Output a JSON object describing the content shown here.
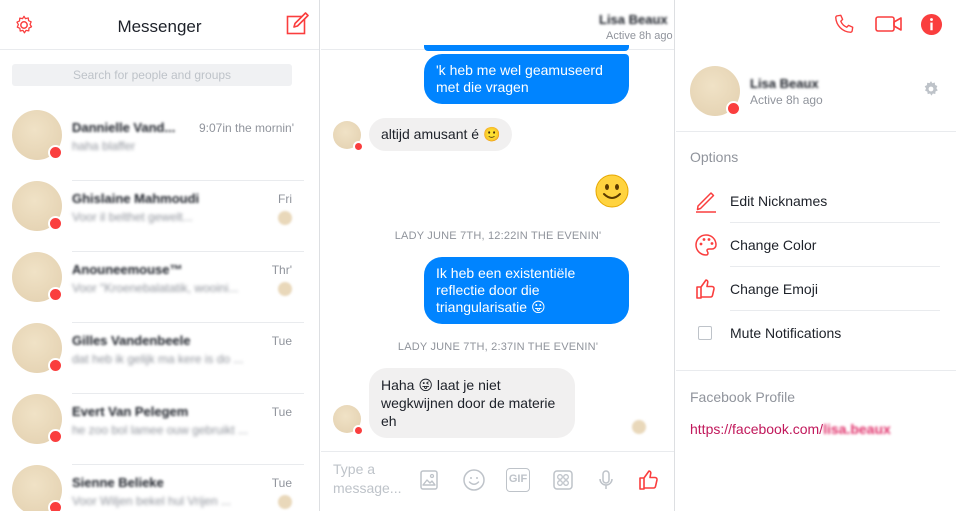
{
  "app": {
    "title": "Messenger",
    "search_placeholder": "Search for people and groups"
  },
  "conversations": [
    {
      "name": "Dannielle Vand...",
      "snippet": "haha blaffer",
      "time": "9:07in the mornin'"
    },
    {
      "name": "Ghislaine Mahmoudi",
      "snippet": "Voor il belthet gewelt...",
      "time": "Fri"
    },
    {
      "name": "Anouneemouse™",
      "snippet": "Voor \"Kroenebalatatik, wooini...",
      "time": "Thr'"
    },
    {
      "name": "Gilles Vandenbeele",
      "snippet": "dat heb ik gelijk ma kere is do ...",
      "time": "Tue"
    },
    {
      "name": "Evert Van Pelegem",
      "snippet": "he zoo bol lamee ouw gebruikt ...",
      "time": "Tue"
    },
    {
      "name": "Sienne Belieke",
      "snippet": "Voor Wiljen bekel hul Vrijen ...",
      "time": "Tue"
    }
  ],
  "chat": {
    "contact_name": "Lisa Beaux",
    "status": "Active 8h ago",
    "messages": [
      {
        "from": "me",
        "text": "'k heb me wel geamuseerd met die vragen"
      },
      {
        "from": "them",
        "text": "altijd amusant é 🙂"
      },
      {
        "from": "me",
        "text": "🙂"
      },
      {
        "from": "them",
        "text": "LADY JUNE 7TH, 12:22IN THE EVENIN'"
      },
      {
        "from": "me",
        "text": "Ik heb een existentiële reflectie  door die triangularisatie 😛"
      },
      {
        "from": "them",
        "text": "LADY JUNE 7TH, 2:37IN THE EVENIN'"
      },
      {
        "from": "them",
        "text": "Haha 😜 laat je niet wegkwijnen door de materie eh"
      }
    ],
    "timestamps": [
      "LADY JUNE 7TH, 12:22IN THE EVENIN'",
      "LADY JUNE 7TH, 2:37IN THE EVENIN'"
    ],
    "composer_placeholder": "Type a message...",
    "gif_label": "GIF"
  },
  "details": {
    "name": "Lisa Beaux",
    "status": "Active 8h ago",
    "options_title": "Options",
    "options": [
      "Edit Nicknames",
      "Change Color",
      "Change Emoji",
      "Mute Notifications"
    ],
    "profile_title": "Facebook Profile",
    "profile_link_prefix": "https://facebook.com/",
    "profile_link_user": "lisa.beaux"
  },
  "colors": {
    "accent": "#fa3e3e",
    "my_bubble": "#0084ff",
    "their_bubble": "#f1f0f0"
  },
  "icons": [
    "gear-icon",
    "compose-icon",
    "phone-icon",
    "video-icon",
    "info-icon",
    "pencil-icon",
    "palette-icon",
    "thumbs-up-icon",
    "sticker-icon",
    "emoji-icon",
    "gif-icon",
    "camera-icon",
    "microphone-icon"
  ]
}
